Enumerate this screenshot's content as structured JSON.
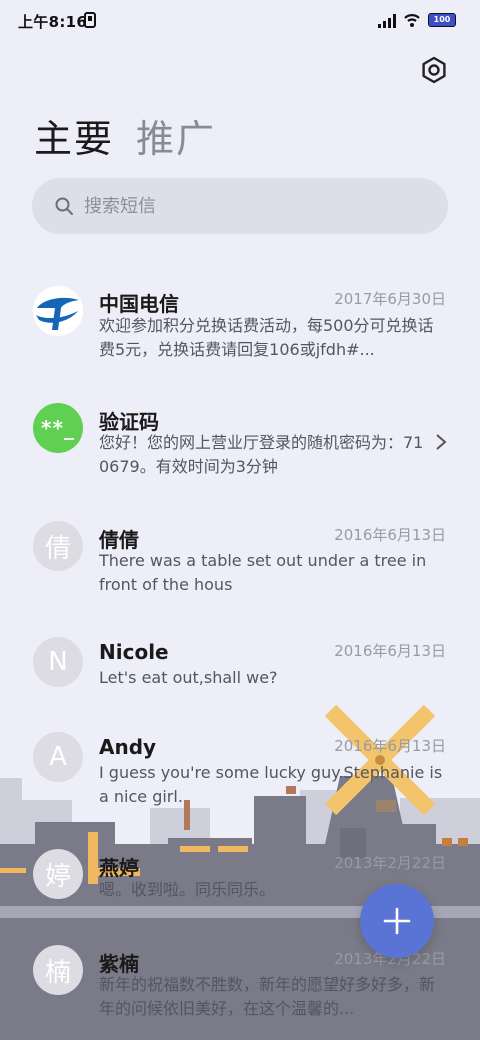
{
  "status_bar": {
    "time": "上午8:16",
    "battery_level": "100",
    "icons": [
      "sim-icon",
      "signal-icon",
      "wifi-icon",
      "battery-icon"
    ]
  },
  "header": {
    "settings_icon": "gear-icon",
    "tabs": [
      {
        "label": "主要",
        "active": true
      },
      {
        "label": "推广",
        "active": false
      }
    ]
  },
  "search": {
    "placeholder": "搜索短信",
    "icon": "search-icon"
  },
  "messages": [
    {
      "name": "中国电信",
      "date": "2017年6月30日",
      "preview": "欢迎参加积分兑换话费活动，每500分可兑换话费5元，兑换话费请回复106或jfdh#...",
      "avatar": "telecom-logo"
    },
    {
      "name": "验证码",
      "date": "",
      "preview": "您好！您的网上营业厅登录的随机密码为：710679。有效时间为3分钟",
      "avatar_text": "**_"
    },
    {
      "name": "倩倩",
      "date": "2016年6月13日",
      "preview": "There was a table set out under a tree in front of the hous",
      "avatar_text": "倩"
    },
    {
      "name": "Nicole",
      "date": "2016年6月13日",
      "preview": "Let's eat out,shall we?",
      "avatar_text": "N"
    },
    {
      "name": "Andy",
      "date": "2016年6月13日",
      "preview": "I guess you're some lucky guy.Stephanie is a nice girl.",
      "avatar_text": "A"
    },
    {
      "name": "燕婷",
      "date": "2013年2月22日",
      "preview": "嗯。收到啦。同乐同乐。",
      "avatar_text": "婷"
    },
    {
      "name": "紫楠",
      "date": "2013年2月22日",
      "preview": "新年的祝福数不胜数，新年的愿望好多好多，新年的问候依旧美好，在这个温馨的...",
      "avatar_text": "楠"
    }
  ],
  "fab": {
    "icon": "plus-icon"
  },
  "colors": {
    "background": "#eeeef8",
    "accent": "#5a74d6",
    "verify_avatar": "#5fd052",
    "telecom_blue": "#1565b8"
  }
}
